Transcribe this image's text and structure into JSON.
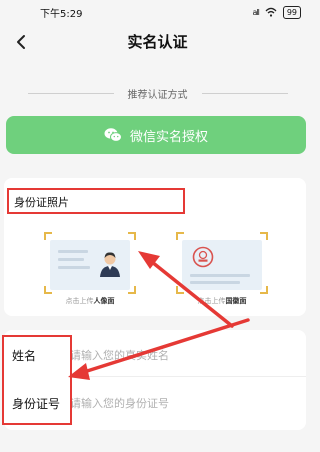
{
  "status_bar": {
    "time": "下午5:29",
    "signal": "all",
    "wifi_icon": "wifi-icon",
    "battery": "99"
  },
  "header": {
    "title": "实名认证",
    "back_icon": "chevron-left-icon"
  },
  "recommend": {
    "label": "推荐认证方式"
  },
  "wechat_button": {
    "label": "微信实名授权",
    "icon": "wechat-icon",
    "color": "#6fd07d"
  },
  "photo_section": {
    "title": "身份证照片",
    "front_caption_prefix": "点击上传",
    "front_caption_bold": "人像面",
    "back_caption_prefix": "点击上传",
    "back_caption_bold": "国徽面"
  },
  "form": {
    "name_label": "姓名",
    "name_placeholder": "请输入您的真实姓名",
    "id_label": "身份证号",
    "id_placeholder": "请输入您的身份证号"
  },
  "annotation_color": "#e53935"
}
